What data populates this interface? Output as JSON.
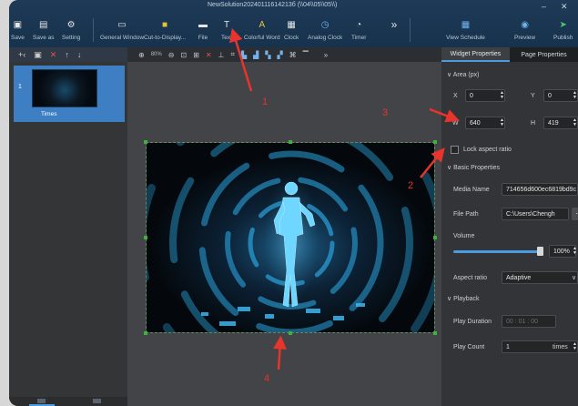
{
  "window": {
    "title": "NewSolution20240111614213б (\\\\04\\\\05\\\\05\\\\)"
  },
  "toolbar": {
    "buttons": [
      {
        "label": "Save"
      },
      {
        "label": "Save as"
      },
      {
        "label": "Setting"
      },
      {
        "label": "General Window"
      },
      {
        "label": "Cut-to-Display..."
      },
      {
        "label": "File"
      },
      {
        "label": "Text"
      },
      {
        "label": "Colorful Word"
      },
      {
        "label": "Clock"
      },
      {
        "label": "Analog Clock"
      },
      {
        "label": "Timer"
      },
      {
        "label": "View Schedule"
      },
      {
        "label": "Preview"
      },
      {
        "label": "Publish"
      }
    ],
    "more": "»"
  },
  "left_panel": {
    "page": {
      "number": "1",
      "name": "Times"
    }
  },
  "canvas_toolbar": {
    "zoom": "80%",
    "more": "»"
  },
  "right_panel": {
    "tabs": [
      "Widget Properties",
      "Page Properties"
    ],
    "area": {
      "header": "Area (px)",
      "x_label": "X",
      "x_value": "0",
      "y_label": "Y",
      "y_value": "0",
      "w_label": "W",
      "w_value": "640",
      "h_label": "H",
      "h_value": "419",
      "lock_label": "Lock aspect ratio"
    },
    "basic": {
      "header": "Basic Properties",
      "media_name_label": "Media Name",
      "media_name_value": "714656d600ec6819bd9c",
      "file_path_label": "File Path",
      "file_path_value": "C:\\Users\\Chengh",
      "browse": "...",
      "volume_label": "Volume",
      "volume_value": "100%",
      "volume_level": 0.95,
      "aspect_label": "Aspect ratio",
      "aspect_value": "Adaptive"
    },
    "playback": {
      "header": "Playback",
      "duration_label": "Play Duration",
      "duration_value": "00 : 01 : 00",
      "count_label": "Play Count",
      "count_value": "1",
      "count_unit": "times"
    }
  },
  "annotations": [
    "1",
    "2",
    "3",
    "4"
  ],
  "colors": {
    "accent": "#4a9be0",
    "arrow": "#e8342a",
    "selection": "#3d7fc2"
  }
}
